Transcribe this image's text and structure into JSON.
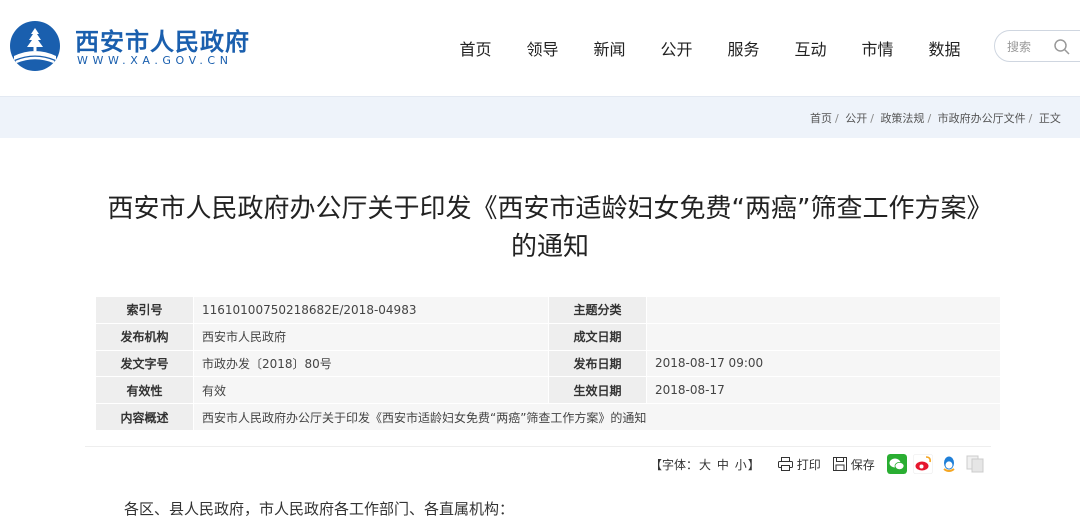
{
  "site": {
    "title": "西安市人民政府",
    "url": "WWW.XA.GOV.CN",
    "brand_color": "#1a5fae"
  },
  "nav": {
    "items": [
      {
        "label": "首页"
      },
      {
        "label": "领导"
      },
      {
        "label": "新闻"
      },
      {
        "label": "公开"
      },
      {
        "label": "服务"
      },
      {
        "label": "互动"
      },
      {
        "label": "市情"
      },
      {
        "label": "数据"
      }
    ]
  },
  "search": {
    "placeholder": "搜索",
    "icon": "search-icon"
  },
  "breadcrumb": {
    "items": [
      {
        "label": "首页"
      },
      {
        "label": "公开"
      },
      {
        "label": "政策法规"
      },
      {
        "label": "市政府办公厅文件"
      },
      {
        "label": "正文"
      }
    ],
    "separator": "/"
  },
  "article": {
    "title_line1": "西安市人民政府办公厅关于印发《西安市适龄妇女免费“两癌”筛查工作方案》",
    "title_line2": "的通知",
    "greeting": "各区、县人民政府，市人民政府各工作部门、各直属机构："
  },
  "info": {
    "index_label": "索引号",
    "index_value": "11610100750218682E/2018-04983",
    "topic_label": "主题分类",
    "topic_value": "",
    "publisher_label": "发布机构",
    "publisher_value": "西安市人民政府",
    "created_label": "成文日期",
    "created_value": "",
    "docno_label": "发文字号",
    "docno_value": "市政办发〔2018〕80号",
    "published_label": "发布日期",
    "published_value": "2018-08-17 09:00",
    "validity_label": "有效性",
    "validity_value": "有效",
    "effective_label": "生效日期",
    "effective_value": "2018-08-17",
    "summary_label": "内容概述",
    "summary_value": "西安市人民政府办公厅关于印发《西安市适龄妇女免费“两癌”筛查工作方案》的通知"
  },
  "tools": {
    "font_open": "【字体：",
    "font_large": "大",
    "font_medium": "中",
    "font_small": "小",
    "font_close": "】",
    "print_label": "打印",
    "save_label": "保存",
    "share_icons": [
      "wechat-icon",
      "weibo-icon",
      "qq-icon",
      "copy-icon"
    ]
  }
}
